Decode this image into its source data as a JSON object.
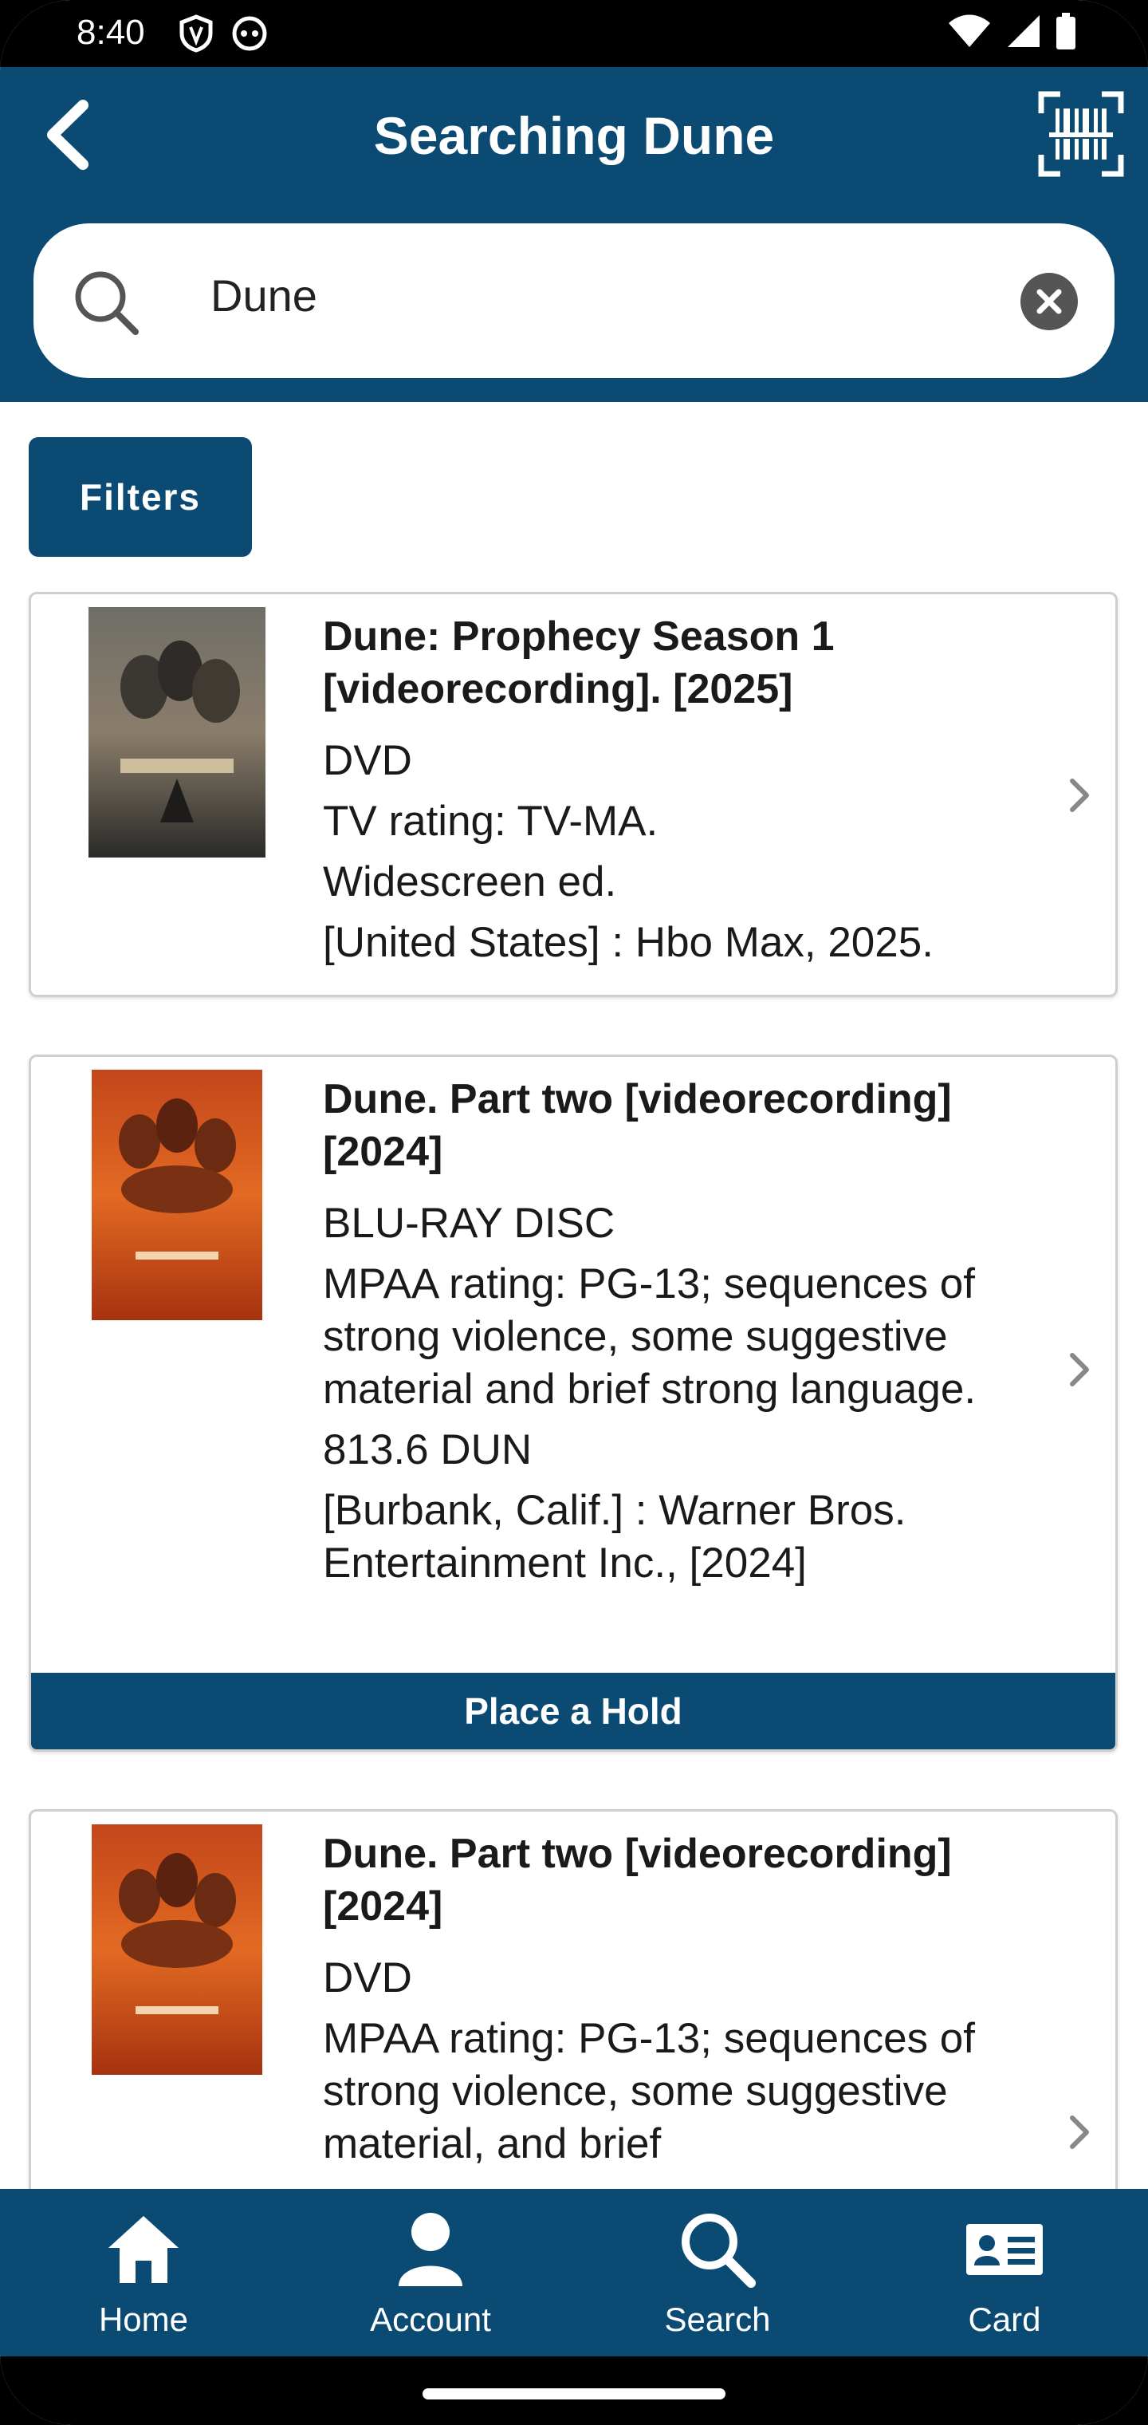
{
  "status_bar": {
    "time": "8:40"
  },
  "header": {
    "title": "Searching Dune",
    "back_icon": "chevron-left-icon",
    "barcode_icon": "barcode-scan-icon"
  },
  "search": {
    "value": "Dune"
  },
  "filters": {
    "label": "Filters"
  },
  "results": [
    {
      "title": "Dune: Prophecy Season 1 [videorecording]. [2025]",
      "lines": [
        "DVD",
        "TV rating: TV-MA.",
        "Widescreen ed.",
        "[United States] : Hbo Max, 2025."
      ]
    },
    {
      "title": "Dune. Part two [videorecording] [2024]",
      "lines": [
        "BLU-RAY DISC",
        "MPAA rating: PG-13; sequences of strong violence, some suggestive material and brief strong language.",
        "813.6 DUN",
        "[Burbank, Calif.] : Warner Bros. Entertainment Inc., [2024]"
      ],
      "hold_label": "Place a Hold"
    },
    {
      "title": "Dune. Part two [videorecording] [2024]",
      "lines": [
        "DVD",
        "MPAA rating: PG-13; sequences of strong violence, some suggestive material, and brief"
      ]
    }
  ],
  "nav": [
    {
      "label": "Home",
      "icon": "home-icon"
    },
    {
      "label": "Account",
      "icon": "account-icon"
    },
    {
      "label": "Search",
      "icon": "search-icon"
    },
    {
      "label": "Card",
      "icon": "card-icon"
    }
  ],
  "colors": {
    "primary": "#0a4a73"
  }
}
